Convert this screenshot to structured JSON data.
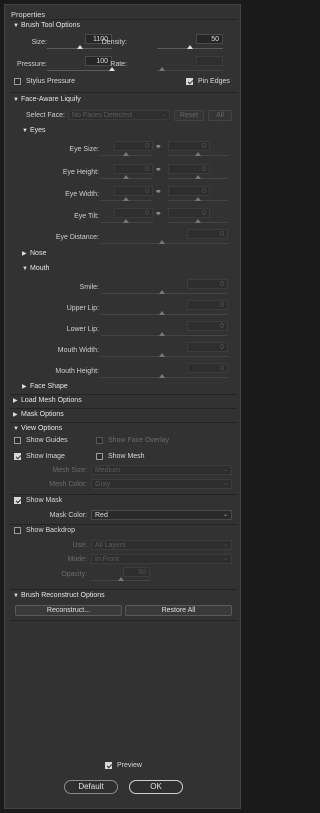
{
  "panel": {
    "title": "Properties"
  },
  "brush": {
    "header": "Brush Tool Options",
    "size_label": "Size:",
    "size_value": "1100",
    "density_label": "Density:",
    "density_value": "50",
    "pressure_label": "Pressure:",
    "pressure_value": "100",
    "rate_label": "Rate:",
    "rate_value": "",
    "stylus_label": "Stylus Pressure",
    "pinedges_label": "Pin Edges"
  },
  "face": {
    "header": "Face-Aware Liquify",
    "select_label": "Select Face:",
    "select_value": "No Faces Detected",
    "reset_label": "Reset",
    "all_label": "All",
    "eyes_header": "Eyes",
    "eye_size_label": "Eye Size:",
    "eye_height_label": "Eye Height:",
    "eye_width_label": "Eye Width:",
    "eye_tilt_label": "Eye Tilt:",
    "eye_distance_label": "Eye Distance:",
    "eye_left_value": "0",
    "eye_right_value": "0",
    "nose_header": "Nose",
    "mouth_header": "Mouth",
    "smile_label": "Smile:",
    "upper_lip_label": "Upper Lip:",
    "lower_lip_label": "Lower Lip:",
    "mouth_width_label": "Mouth Width:",
    "mouth_height_label": "Mouth Height:",
    "mouth_value": "0",
    "face_shape_header": "Face Shape"
  },
  "load_mesh": {
    "header": "Load Mesh Options"
  },
  "mask_options": {
    "header": "Mask Options"
  },
  "view": {
    "header": "View Options",
    "show_guides": "Show Guides",
    "show_face_overlay": "Show Face Overlay",
    "show_image": "Show Image",
    "show_mesh": "Show Mesh",
    "mesh_size_label": "Mesh Size:",
    "mesh_size_value": "Medium",
    "mesh_color_label": "Mesh Color:",
    "mesh_color_value": "Gray",
    "show_mask": "Show Mask",
    "mask_color_label": "Mask Color:",
    "mask_color_value": "Red",
    "show_backdrop": "Show Backdrop",
    "use_label": "Use:",
    "use_value": "All Layers",
    "mode_label": "Mode:",
    "mode_value": "In Front",
    "opacity_label": "Opacity:",
    "opacity_value": "50"
  },
  "reconstruct": {
    "header": "Brush Reconstruct Options",
    "reconstruct_label": "Reconstruct...",
    "restore_label": "Restore All"
  },
  "footer": {
    "preview_label": "Preview",
    "default_label": "Default",
    "ok_label": "OK"
  }
}
